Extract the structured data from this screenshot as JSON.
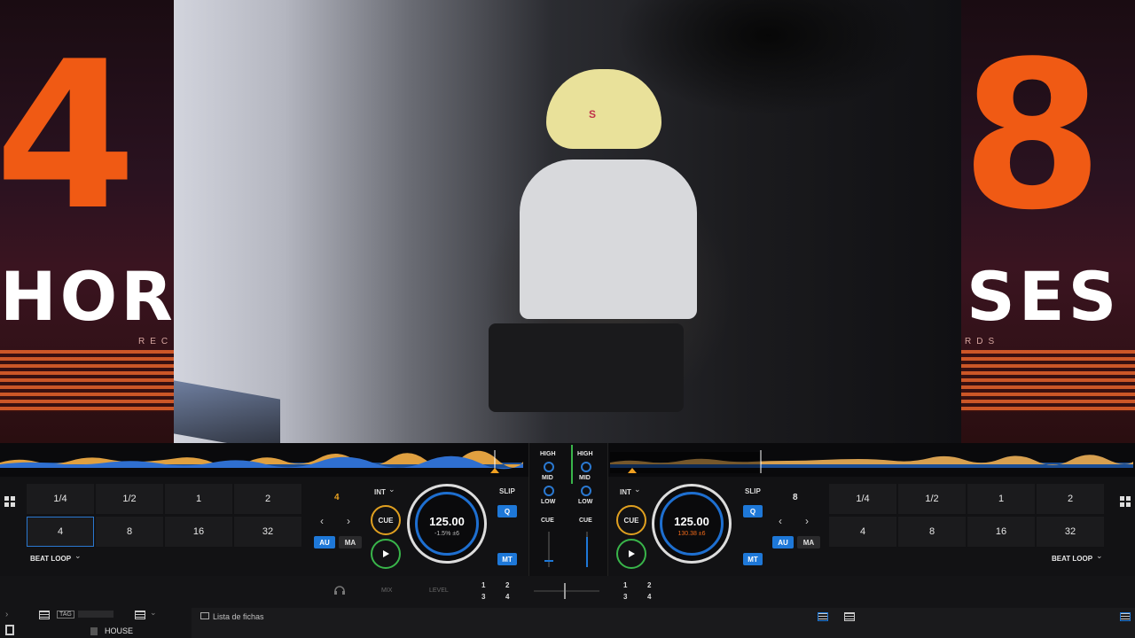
{
  "video": {
    "left_banner": {
      "big_text": "4",
      "word": "HOR",
      "small": "REC"
    },
    "right_banner": {
      "big_text": "8",
      "word": "SES",
      "small": "RDS"
    },
    "cap_logo": "S"
  },
  "deck_left": {
    "pads_row1": [
      "1/4",
      "1/2",
      "1",
      "2"
    ],
    "pads_row2": [
      "4",
      "8",
      "16",
      "32"
    ],
    "selected_pad": "4",
    "loop_mode": "BEAT LOOP",
    "loop_size": "4",
    "int_label": "INT",
    "cue_label": "CUE",
    "slip_label": "SLIP",
    "q_label": "Q",
    "au_label": "AU",
    "ma_label": "MA",
    "mt_label": "MT",
    "bpm": "125.00",
    "pitch": "-1.5% ±6"
  },
  "deck_right": {
    "pads_row1": [
      "1/4",
      "1/2",
      "1",
      "2"
    ],
    "pads_row2": [
      "4",
      "8",
      "16",
      "32"
    ],
    "loop_mode": "BEAT LOOP",
    "loop_size": "8",
    "int_label": "INT",
    "cue_label": "CUE",
    "slip_label": "SLIP",
    "q_label": "Q",
    "au_label": "AU",
    "ma_label": "MA",
    "mt_label": "MT",
    "bpm": "125.00",
    "pitch": "130.38 ±6"
  },
  "mixer": {
    "left": {
      "high": "HIGH",
      "mid": "MID",
      "low": "LOW",
      "cue": "CUE"
    },
    "right": {
      "high": "HIGH",
      "mid": "MID",
      "low": "LOW",
      "cue": "CUE"
    }
  },
  "bottom_strip": {
    "mix_label": "MIX",
    "level_label": "LEVEL",
    "left_fx": [
      "1",
      "2",
      "3",
      "4"
    ],
    "right_fx": [
      "1",
      "2",
      "3",
      "4"
    ]
  },
  "browser": {
    "title": "Lista de fichas",
    "folder": "HOUSE",
    "tag_label": "TAG"
  },
  "colors": {
    "accent_blue": "#1e78d8",
    "cue_orange": "#e0a020",
    "play_green": "#39b54a",
    "loop_orange": "#e8a020",
    "banner_orange": "#f05a14"
  }
}
